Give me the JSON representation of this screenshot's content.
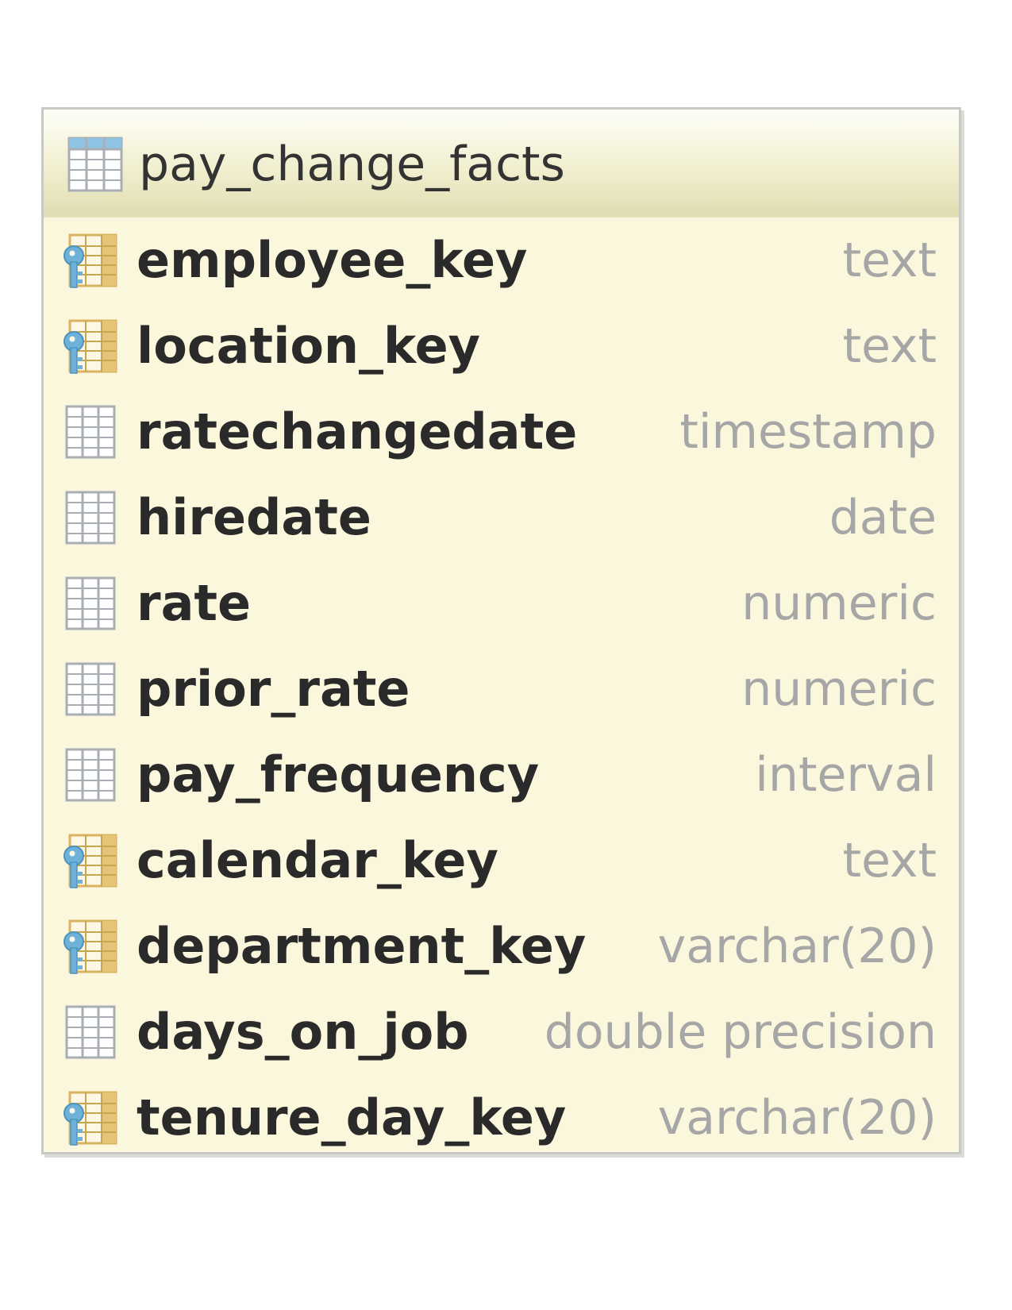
{
  "table": {
    "name": "pay_change_facts",
    "icon": "table-icon",
    "columns": [
      {
        "name": "employee_key",
        "type": "text",
        "icon": "key-column-icon"
      },
      {
        "name": "location_key",
        "type": "text",
        "icon": "key-column-icon"
      },
      {
        "name": "ratechangedate",
        "type": "timestamp",
        "icon": "column-icon"
      },
      {
        "name": "hiredate",
        "type": "date",
        "icon": "column-icon"
      },
      {
        "name": "rate",
        "type": "numeric",
        "icon": "column-icon"
      },
      {
        "name": "prior_rate",
        "type": "numeric",
        "icon": "column-icon"
      },
      {
        "name": "pay_frequency",
        "type": "interval",
        "icon": "column-icon"
      },
      {
        "name": "calendar_key",
        "type": "text",
        "icon": "key-column-icon"
      },
      {
        "name": "department_key",
        "type": "varchar(20)",
        "icon": "key-column-icon"
      },
      {
        "name": "days_on_job",
        "type": "double precision",
        "icon": "column-icon"
      },
      {
        "name": "tenure_day_key",
        "type": "varchar(20)",
        "icon": "key-column-icon"
      }
    ]
  },
  "colors": {
    "card_background": "#fbf7dc",
    "card_border": "#c9c9c3",
    "header_gradient_top": "#fefef8",
    "header_gradient_bottom": "#e0ddb2",
    "column_name": "#2a2a2a",
    "column_type": "#a6a6a6",
    "key_blue": "#6fb2d9",
    "key_gold": "#d9b35f",
    "grid_gray": "#a9aeb4"
  }
}
